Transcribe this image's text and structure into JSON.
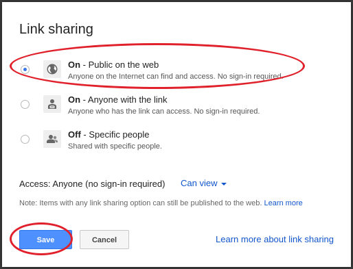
{
  "dialog": {
    "title": "Link sharing",
    "options": [
      {
        "bold": "On",
        "rest": " - Public on the web",
        "desc": "Anyone on the Internet can find and access. No sign-in required.",
        "selected": true,
        "icon": "globe-icon"
      },
      {
        "bold": "On",
        "rest": " - Anyone with the link",
        "desc": "Anyone who has the link can access. No sign-in required.",
        "selected": false,
        "icon": "link-person-icon"
      },
      {
        "bold": "Off",
        "rest": " - Specific people",
        "desc": "Shared with specific people.",
        "selected": false,
        "icon": "people-icon"
      }
    ],
    "access_label": "Access:  Anyone (no sign-in required)",
    "access_dropdown": "Can view",
    "note_text": "Note: Items with any link sharing option can still be published to the web.",
    "note_link": "Learn more",
    "save_label": "Save",
    "cancel_label": "Cancel",
    "learn_more_link": "Learn more about link sharing"
  },
  "colors": {
    "accent": "#4d90fe",
    "link": "#1155cc",
    "annotation": "#e0202a"
  }
}
